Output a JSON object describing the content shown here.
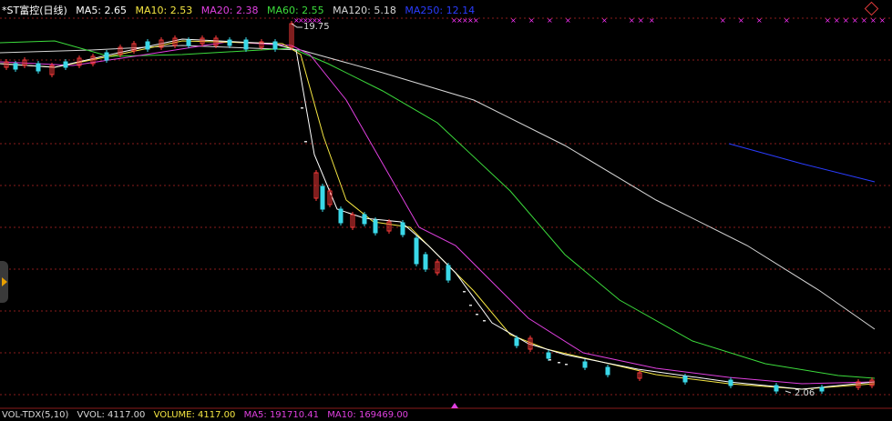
{
  "legend": {
    "title": "*ST富控(日线)",
    "title_color": "#ffffff",
    "items": [
      {
        "label": "MA5: 2.65",
        "color": "#ffffff"
      },
      {
        "label": "MA10: 2.53",
        "color": "#f5e642"
      },
      {
        "label": "MA20: 2.38",
        "color": "#e040e0"
      },
      {
        "label": "MA60: 2.55",
        "color": "#3cdc3c"
      },
      {
        "label": "MA120: 5.18",
        "color": "#d8d8d8"
      },
      {
        "label": "MA250: 12.14",
        "color": "#2a3cff"
      }
    ]
  },
  "bottom_legend": {
    "items": [
      {
        "label": "VOL-TDX(5,10)",
        "color": "#d8d8d8"
      },
      {
        "label": "VVOL: 4117.00",
        "color": "#d8d8d8"
      },
      {
        "label": "VOLUME: 4117.00",
        "color": "#f5e642"
      },
      {
        "label": "MA5: 191710.41",
        "color": "#e040e0"
      },
      {
        "label": "MA10: 169469.00",
        "color": "#e040e0"
      }
    ]
  },
  "annotations": {
    "high_price": "19.75",
    "low_price": "2.06"
  },
  "colors": {
    "background": "#000000",
    "grid": "#8a1c1c",
    "up_candle": "#ff3b3b",
    "down_candle": "#3ad8e8",
    "limit_marker": "#ff33ff"
  },
  "chart_data": {
    "type": "candlestick",
    "title": "*ST富控(日线)",
    "y_range": [
      1.6,
      21.2
    ],
    "series": [
      {
        "name": "MA5",
        "last": 2.65
      },
      {
        "name": "MA10",
        "last": 2.53
      },
      {
        "name": "MA20",
        "last": 2.38
      },
      {
        "name": "MA60",
        "last": 2.55
      },
      {
        "name": "MA120",
        "last": 5.18
      },
      {
        "name": "MA250",
        "last": 12.14
      }
    ],
    "highest": 19.75,
    "lowest": 2.06
  }
}
